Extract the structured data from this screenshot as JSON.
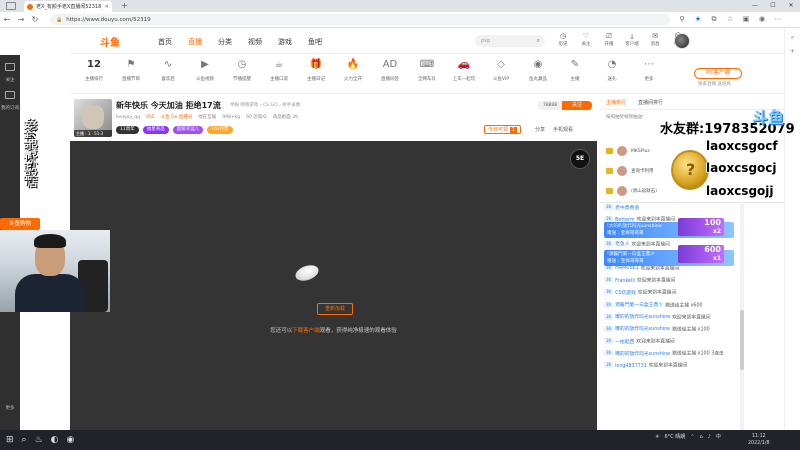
{
  "browser": {
    "tab_title": "老X_有颜手老X直播间52318_在",
    "url": "https://www.douyu.com/52319"
  },
  "site": {
    "logo": "斗鱼",
    "menu": [
      "首页",
      "直播",
      "分类",
      "视频",
      "游戏",
      "鱼吧"
    ],
    "search_placeholder": "pvp",
    "header_icons": [
      "历史",
      "关注",
      "开播",
      "客户端",
      "消息",
      "中心"
    ]
  },
  "categories": [
    {
      "label": "主播排行",
      "count": "12"
    },
    {
      "label": "直播节目",
      "icon": "flag-icon"
    },
    {
      "label": "喜欢后",
      "icon": "wave-icon"
    },
    {
      "label": "斗鱼视频",
      "icon": "play-icon"
    },
    {
      "label": "节播提醒",
      "icon": "clock-icon"
    },
    {
      "label": "主播口袋",
      "icon": "cup-icon"
    },
    {
      "label": "主播日记",
      "icon": "gift-icon"
    },
    {
      "label": "火力全开",
      "icon": "fire-icon"
    },
    {
      "label": "直播间签",
      "icon": "ad-icon"
    },
    {
      "label": "全网车队",
      "icon": "controller-icon"
    },
    {
      "label": "上车一起玩",
      "icon": "car-icon"
    },
    {
      "label": "斗鱼VIP",
      "icon": "diamond-icon"
    },
    {
      "label": "鱼丸藏品",
      "icon": "eye-icon"
    },
    {
      "label": "主播",
      "icon": "chat-icon"
    },
    {
      "label": "送礼",
      "icon": "gauge-icon"
    },
    {
      "label": "更多",
      "icon": "more-icon"
    }
  ],
  "pc_client": {
    "button": "PC客户端",
    "sub": "独家直播 送道具"
  },
  "room": {
    "title": "新年快乐 今天加油 拒绝17流",
    "thumb_caption": "主播 · 1 · 51·3",
    "meta": "举报 网络游戏 › CS:GO › 射手录像",
    "owner": "lovejoy_qq",
    "hot": "955",
    "badge_text": "斗鱼 Go 直播间",
    "tags": [
      "他在互娱",
      "998+kg",
      "60 近观众",
      "商品板面 39"
    ],
    "pills": [
      "11周年",
      "福星商品",
      "超级幸运儿",
      "16k月票"
    ],
    "follow_count": "78888",
    "follow_label": "关注",
    "rank_label": "今日可领",
    "rank_value": "1",
    "actions": [
      "分享",
      "手机观看"
    ]
  },
  "player": {
    "reload_label": "重新加载",
    "hint_pre": "您还可以",
    "hint_link": "下载客户端",
    "hint_post": "观看，获得纯净极速的观看体验",
    "corner_logo": "5E"
  },
  "right": {
    "tabs": [
      "主播排行",
      "直播间排行"
    ],
    "hint": "按照抽奖帧频抽送!"
  },
  "overlay": {
    "fan_group": "水友群:1978352079",
    "aliases": [
      "laoxcsgocf",
      "laoxcsgocj",
      "laoxcsgojj"
    ]
  },
  "rank_rows": [
    {
      "name": "MKSPlus"
    },
    {
      "name": "查询卡利用"
    },
    {
      "name": "(周山返联石)"
    }
  ],
  "chat": [
    {
      "lv": "36",
      "user": "老中鼎香道",
      "text": ""
    },
    {
      "lv": "36",
      "user": "Betterm",
      "text": "欢迎来到本直播间"
    },
    {
      "lv": "36",
      "user": "SNOW",
      "text": "欢迎来到本直播间"
    },
    {
      "lv": "36",
      "user": "老鱼人",
      "text": "欢迎来到本直播间"
    },
    {
      "lv": "36",
      "user": "RGG与被大王",
      "text": "欢迎来到本直播间"
    },
    {
      "lv": "36",
      "user": "HAMUSE1",
      "text": "欢迎来到本直播间"
    },
    {
      "lv": "36",
      "user": "Frankelli",
      "text": "欢迎来到本直播间"
    },
    {
      "lv": "36",
      "user": "CS玩游戏",
      "text": "欢迎来到本直播间"
    },
    {
      "lv": "36",
      "user": "源酱門第一白盒王鼎少",
      "text": "赠送给主播 x600"
    },
    {
      "lv": "36",
      "user": "曝的的放炸吗光sunshine",
      "text": "欢迎来到本直播间"
    },
    {
      "lv": "36",
      "user": "曝的的放炸吗光sunshine",
      "text": "赠送给主播 x100"
    },
    {
      "lv": "36",
      "user": "一拍起西",
      "text": "欢迎来到本直播间"
    },
    {
      "lv": "36",
      "user": "曝的的放炸吗光sunshine",
      "text": "赠送给主播 x100 3连击"
    },
    {
      "lv": "36",
      "user": "long4837731",
      "text": "欢迎来到本直播间"
    }
  ],
  "banners": [
    {
      "line1": "!大的的放炸吗光sunshine",
      "line2": "赠送 : 宝样哥哥哥",
      "gift": "100",
      "mult": "x2"
    },
    {
      "line1": "!源酱門第一白盒王鼎少",
      "line2": "赠送 : 宝样哥哥哥",
      "gift": "600",
      "mult": "x1"
    }
  ],
  "taskbar": {
    "weather": "6°C 晴朗",
    "time": "11:12",
    "date": "2022/1/8"
  },
  "leftpanel": {
    "labels": [
      "关注",
      "我的订阅",
      "更多"
    ],
    "vertical1": "老X电竞外设店",
    "vertical2": "安全 可靠 正品",
    "shop_badge": "斗鱼购物"
  },
  "colors": {
    "accent": "#ff6a00",
    "player_bg": "#343434",
    "link": "#2b7de9"
  }
}
